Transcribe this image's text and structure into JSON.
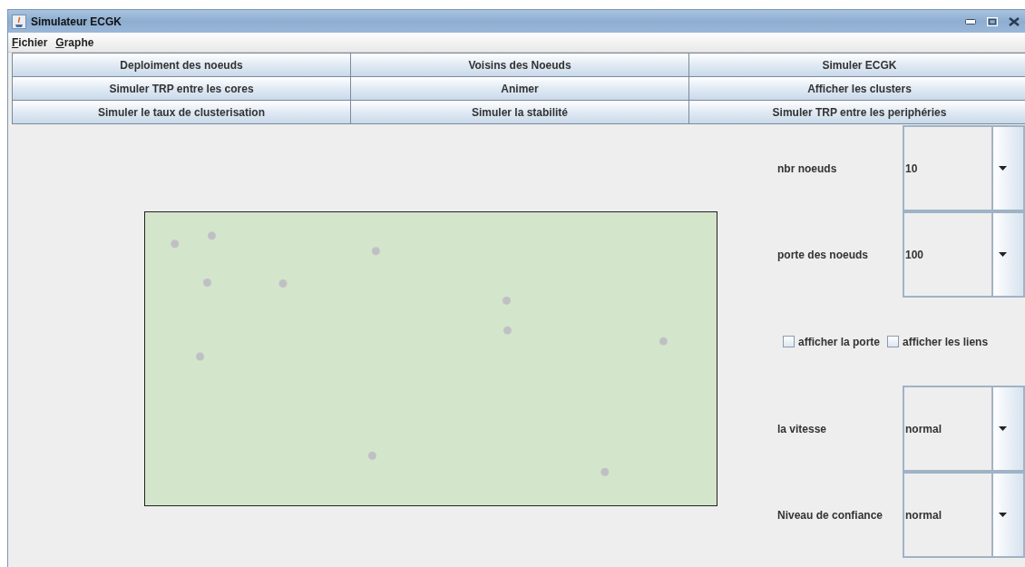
{
  "window": {
    "title": "Simulateur ECGK"
  },
  "menu": [
    {
      "label": "Fichier"
    },
    {
      "label": "Graphe"
    }
  ],
  "buttons": [
    "Deploiment des noeuds",
    "Voisins des Noeuds",
    "Simuler ECGK",
    "Simuler TRP entre les cores",
    "Animer",
    "Afficher les clusters",
    "Simuler le taux de clusterisation",
    "Simuler la stabilité",
    "Simuler TRP entre les periphéries"
  ],
  "settings": [
    {
      "kind": "combo",
      "label": "nbr noeuds",
      "value": "10"
    },
    {
      "kind": "combo",
      "label": "porte des noeuds",
      "value": "100"
    },
    {
      "kind": "checks",
      "items": [
        {
          "label": "afficher la porte",
          "checked": false
        },
        {
          "label": "afficher les liens",
          "checked": false
        }
      ]
    },
    {
      "kind": "combo",
      "label": "la vitesse",
      "value": "normal"
    },
    {
      "kind": "combo",
      "label": "Niveau de confiance",
      "value": "normal"
    }
  ]
}
